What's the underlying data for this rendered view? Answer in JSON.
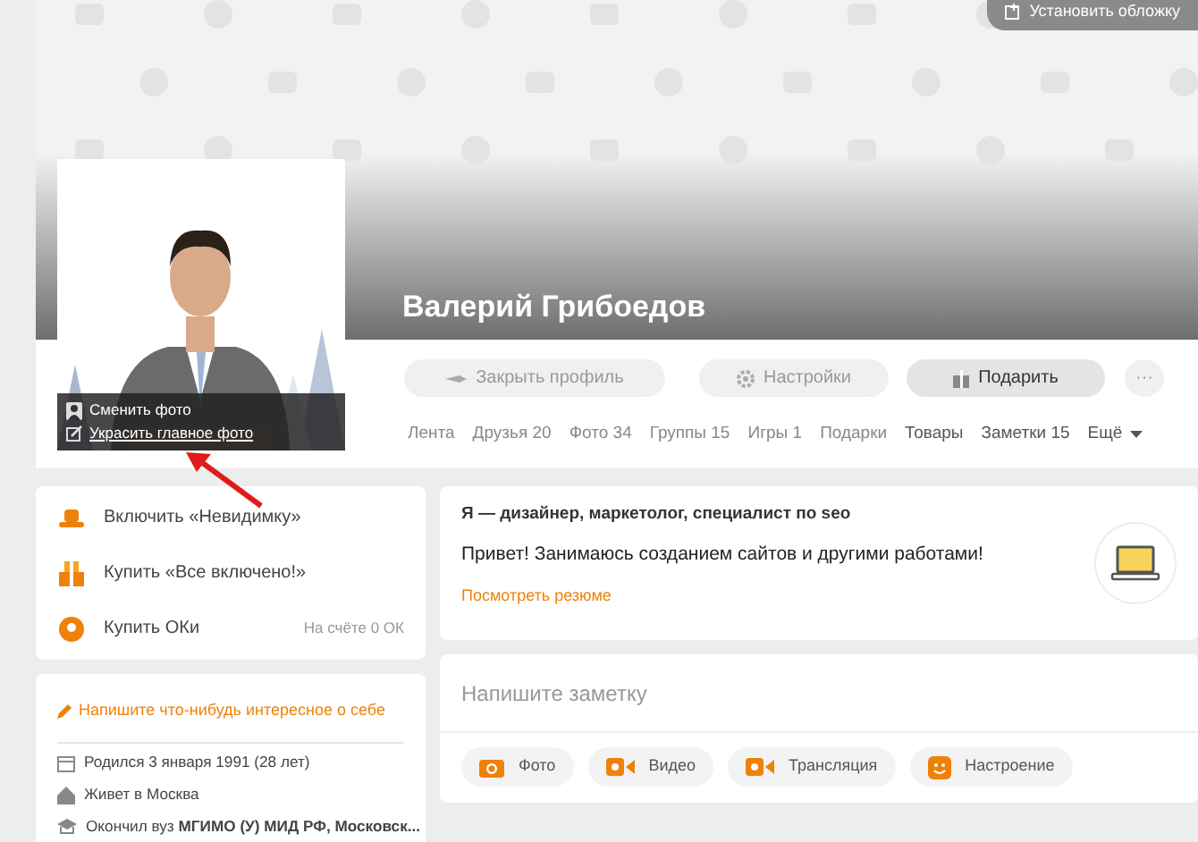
{
  "cover": {
    "button": "Установить обложку"
  },
  "profile": {
    "name": "Валерий Грибоедов",
    "photo_actions": [
      {
        "label": "Сменить фото",
        "kind": "user"
      },
      {
        "label": "Украсить главное фото",
        "kind": "edit"
      }
    ]
  },
  "actions": [
    {
      "label": "Закрыть профиль",
      "kind": "lock"
    },
    {
      "label": "Настройки",
      "kind": "gear"
    },
    {
      "label": "Подарить",
      "kind": "gift"
    },
    {
      "label": "···",
      "kind": "more"
    }
  ],
  "tabs": [
    {
      "label": "Лента"
    },
    {
      "label": "Друзья 20"
    },
    {
      "label": "Фото 34"
    },
    {
      "label": "Группы 15"
    },
    {
      "label": "Игры 1"
    },
    {
      "label": "Подарки"
    },
    {
      "label": "Товары"
    },
    {
      "label": "Заметки 15"
    },
    {
      "label": "Ещё",
      "kind": "dropdown"
    }
  ],
  "services": [
    {
      "label": "Включить «Невидимку»",
      "kind": "hat"
    },
    {
      "label": "Купить «Все включено!»",
      "kind": "gifts"
    },
    {
      "label": "Купить ОКи",
      "kind": "coin",
      "note": "На счёте 0 ОК"
    }
  ],
  "about": {
    "prompt": "Напишите что-нибудь интересное о себе",
    "facts": [
      {
        "kind": "birthday",
        "text": "Родился 3 января 1991 (28 лет)"
      },
      {
        "kind": "home",
        "text": "Живет в Москва"
      },
      {
        "kind": "education",
        "text": "Окончил вуз **МГИМО (У) МИД РФ, Московск...**"
      }
    ]
  },
  "bio": {
    "title": "Я — дизайнер, маркетолог, специалист по seo",
    "text": "Привет! Занимаюсь созданием сайтов и другими работами!",
    "link": "Посмотреть резюме"
  },
  "note": {
    "placeholder": "Напишите заметку",
    "buttons": [
      {
        "label": "Фото",
        "kind": "camera"
      },
      {
        "label": "Видео",
        "kind": "video"
      },
      {
        "label": "Трансляция",
        "kind": "video"
      },
      {
        "label": "Настроение",
        "kind": "smile"
      }
    ]
  }
}
